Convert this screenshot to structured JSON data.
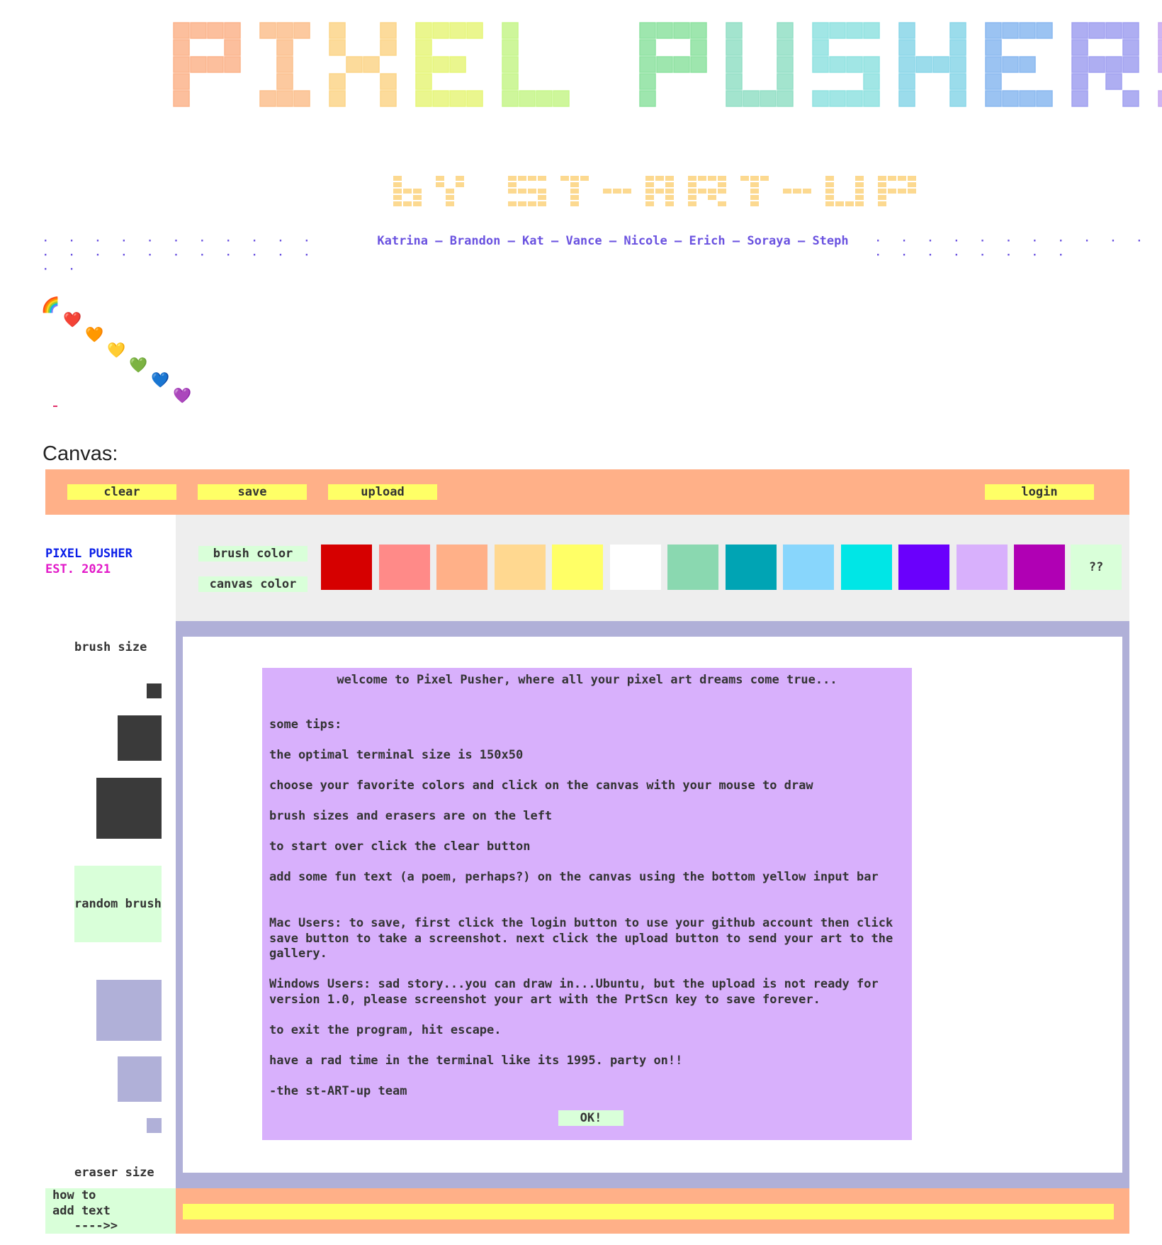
{
  "header": {
    "title": "PIXEL PUSHER!",
    "subtitle": "BY ST-ART-UP",
    "title_colors": [
      "#fbb48c",
      "#fbc08e",
      "#fcd58a",
      "#e6f57a",
      "#c6f58a",
      "#8de2a0",
      "#93dfc6",
      "#90e2e0",
      "#8ad6e8",
      "#8ab8f0",
      "#a0a0f0",
      "#c8a8f0"
    ],
    "subtitle_color": "#fcd990"
  },
  "credits": {
    "names": "Katrina – Brandon – Kat – Vance – Nicole – Erich – Soraya – Steph",
    "dots_left": "· · · · · · · · · · · · · · · · · · · · · · · ·",
    "dots_right": "· · · · · · · · · · · · · · · · · · · ·"
  },
  "hearts": [
    "🌈",
    "❤️",
    "🧡",
    "💛",
    "💚",
    "💙",
    "💜"
  ],
  "canvas_label": "Canvas:",
  "toolbar": {
    "clear": "clear",
    "save": "save",
    "upload": "upload",
    "login": "login"
  },
  "logo": {
    "line1": "PIXEL PUSHER",
    "line2": "EST. 2021"
  },
  "palette": {
    "brush_color": "brush color",
    "canvas_color": "canvas color",
    "swatches": [
      "#d60000",
      "#ff8a88",
      "#ffb088",
      "#ffd890",
      "#ffff66",
      "#ffffff",
      "#8ad8b0",
      "#00a4b4",
      "#88d6fc",
      "#00e6e6",
      "#6a00fc",
      "#d8b0fc",
      "#b000b4"
    ],
    "more": "??"
  },
  "sidebar": {
    "brush_size": "brush size",
    "random_brush": "random brush",
    "eraser_size": "eraser size",
    "brush_color": "#3a3a3a",
    "eraser_color": "#b0b0d8"
  },
  "dialog": {
    "welcome": "welcome to Pixel Pusher, where all your pixel art dreams come true...",
    "tips_heading": "some tips:",
    "tip1": "the optimal terminal size is 150x50",
    "tip2": "choose your favorite colors and click on the canvas with your mouse to draw",
    "tip3": "brush sizes and erasers are on the left",
    "tip4": "to start over click the clear button",
    "tip5": "add some fun text (a poem, perhaps?) on the canvas using the bottom yellow input bar",
    "mac": "Mac Users: to save, first click the login button to use your github account then click save button to take a screenshot. next click the upload button to send your art to the gallery.",
    "windows": "Windows Users: sad story...you can draw in...Ubuntu, but the upload is not ready for version 1.0, please screenshot your art with the PrtScn key to save forever.",
    "exit": "to exit the program, hit escape.",
    "rad": "have a rad time in the terminal like its 1995. party on!!",
    "signoff": "-the st-ART-up team",
    "ok": "OK!"
  },
  "footer": {
    "howto_line1": "how to",
    "howto_line2": "add text",
    "howto_line3": "   ---->>",
    "text_input_value": ""
  }
}
